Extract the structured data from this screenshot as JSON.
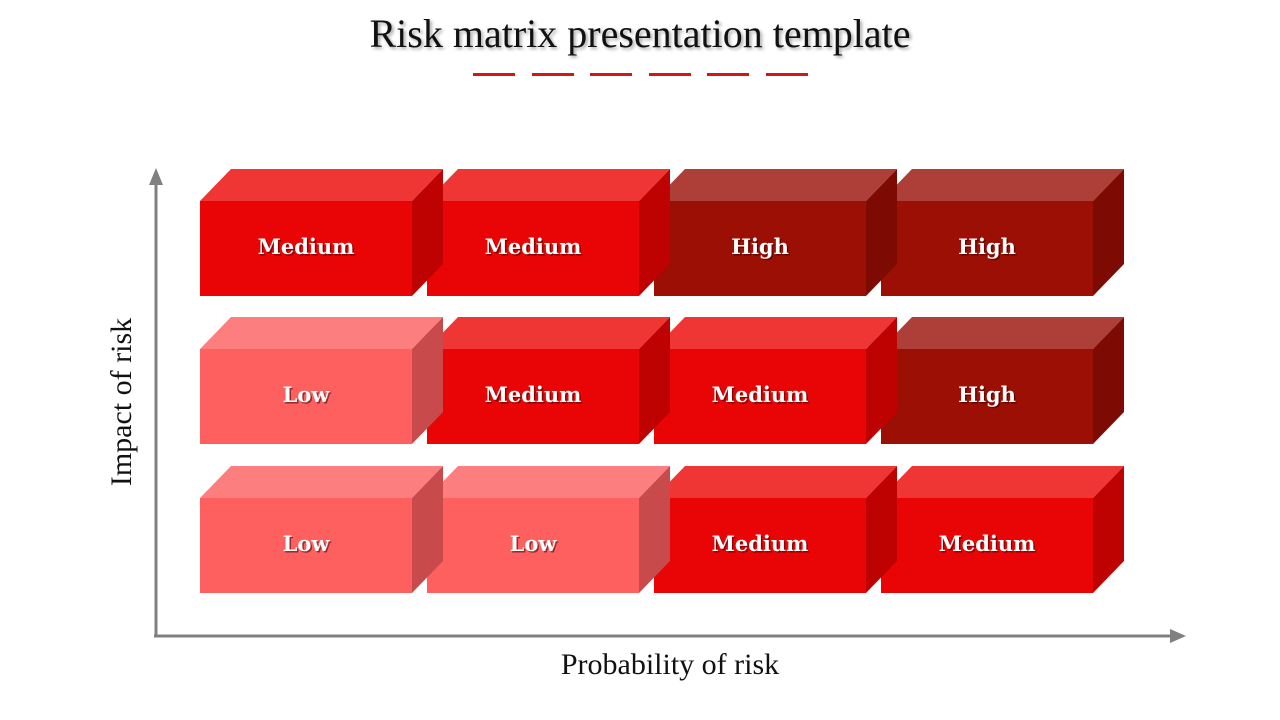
{
  "title": "Risk matrix presentation template",
  "axes": {
    "x_label": "Probability of risk",
    "y_label": "Impact of risk"
  },
  "levels": {
    "Low": {
      "front": "#fe5f5f",
      "top": "#fd7e7e",
      "side": "#c94a4a"
    },
    "Medium": {
      "front": "#e90505",
      "top": "#f03535",
      "side": "#be0202"
    },
    "High": {
      "front": "#9b0f04",
      "top": "#ad3e38",
      "side": "#7d0b03"
    }
  },
  "matrix": {
    "rows": [
      [
        "Medium",
        "Medium",
        "High",
        "High"
      ],
      [
        "Low",
        "Medium",
        "Medium",
        "High"
      ],
      [
        "Low",
        "Low",
        "Medium",
        "Medium"
      ]
    ]
  },
  "decor": {
    "dash_color": "#d31616",
    "axis_color": "#808080",
    "dash_count": 6
  }
}
